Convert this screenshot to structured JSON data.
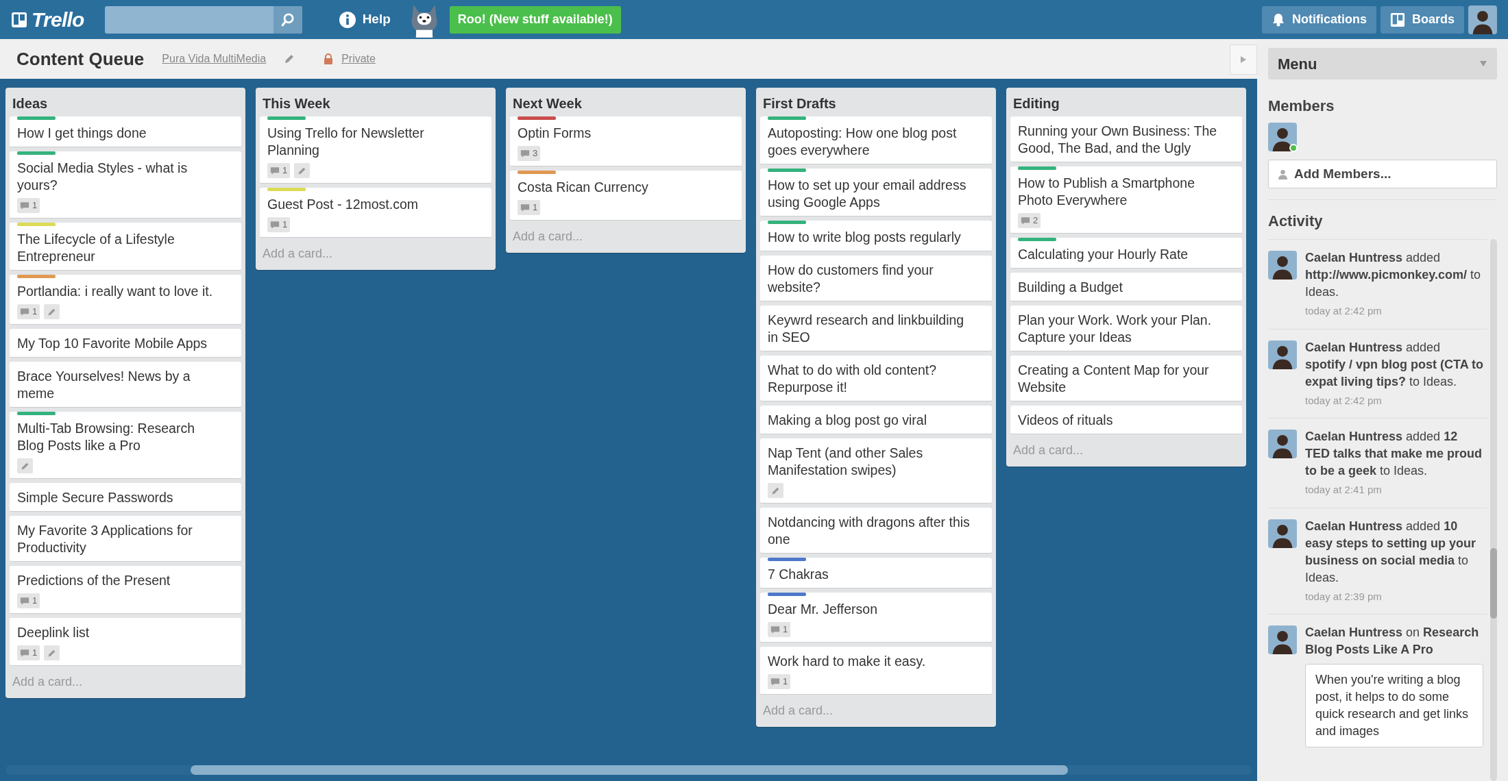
{
  "topbar": {
    "logo": "Trello",
    "help": "Help",
    "announcement": "Roo! (New stuff available!)",
    "notifications": "Notifications",
    "boards": "Boards"
  },
  "board": {
    "title": "Content Queue",
    "organization": "Pura Vida MultiMedia",
    "visibility": "Private"
  },
  "lists": [
    {
      "name": "Ideas",
      "add_card": "Add a card...",
      "cards": [
        {
          "title": "How I get things done",
          "labels": [
            {
              "color": "#34b27d"
            }
          ]
        },
        {
          "title": "Social Media Styles - what is yours?",
          "labels": [
            {
              "color": "#34b27d"
            }
          ],
          "comments": "1"
        },
        {
          "title": "The Lifecycle of a Lifestyle Entrepreneur",
          "labels": [
            {
              "color": "#dbdb57"
            }
          ]
        },
        {
          "title": "Portlandia: i really want to love it.",
          "labels": [
            {
              "color": "#e09952"
            }
          ],
          "comments": "1",
          "description": true
        },
        {
          "title": "My Top 10 Favorite Mobile Apps"
        },
        {
          "title": "Brace Yourselves! News by a meme"
        },
        {
          "title": "Multi-Tab Browsing: Research Blog Posts like a Pro",
          "labels": [
            {
              "color": "#34b27d"
            }
          ],
          "description": true
        },
        {
          "title": "Simple Secure Passwords"
        },
        {
          "title": "My Favorite 3 Applications for Productivity"
        },
        {
          "title": "Predictions of the Present",
          "comments": "1"
        },
        {
          "title": "Deeplink list",
          "comments": "1",
          "description": true
        }
      ]
    },
    {
      "name": "This Week",
      "add_card": "Add a card...",
      "cards": [
        {
          "title": "Using Trello for Newsletter Planning",
          "labels": [
            {
              "color": "#34b27d"
            }
          ],
          "comments": "1",
          "description": true
        },
        {
          "title": "Guest Post - 12most.com",
          "labels": [
            {
              "color": "#dbdb57"
            }
          ],
          "comments": "1"
        }
      ]
    },
    {
      "name": "Next Week",
      "add_card": "Add a card...",
      "cards": [
        {
          "title": "Optin Forms",
          "labels": [
            {
              "color": "#cb4d4d"
            }
          ],
          "comments": "3"
        },
        {
          "title": "Costa Rican Currency",
          "labels": [
            {
              "color": "#e09952"
            }
          ],
          "comments": "1"
        }
      ]
    },
    {
      "name": "First Drafts",
      "add_card": "Add a card...",
      "cards": [
        {
          "title": "Autoposting: How one blog post goes everywhere",
          "labels": [
            {
              "color": "#34b27d"
            }
          ]
        },
        {
          "title": "How to set up your email address using Google Apps",
          "labels": [
            {
              "color": "#34b27d"
            }
          ]
        },
        {
          "title": "How to write blog posts regularly",
          "labels": [
            {
              "color": "#34b27d"
            }
          ]
        },
        {
          "title": "How do customers find your website?"
        },
        {
          "title": "Keywrd research and linkbuilding in SEO"
        },
        {
          "title": "What to do with old content? Repurpose it!"
        },
        {
          "title": "Making a blog post go viral"
        },
        {
          "title": "Nap Tent (and other Sales Manifestation swipes)",
          "description": true
        },
        {
          "title": "Notdancing with dragons after this one"
        },
        {
          "title": "7 Chakras",
          "labels": [
            {
              "color": "#4d77cb"
            }
          ]
        },
        {
          "title": "Dear Mr. Jefferson",
          "labels": [
            {
              "color": "#4d77cb"
            }
          ],
          "comments": "1"
        },
        {
          "title": "Work hard to make it easy.",
          "comments": "1"
        }
      ]
    },
    {
      "name": "Editing",
      "add_card": "Add a card...",
      "cards": [
        {
          "title": "Running your Own Business: The Good, The Bad, and the Ugly"
        },
        {
          "title": "How to Publish a Smartphone Photo Everywhere",
          "labels": [
            {
              "color": "#34b27d"
            }
          ],
          "comments": "2"
        },
        {
          "title": "Calculating your Hourly Rate",
          "labels": [
            {
              "color": "#34b27d"
            }
          ]
        },
        {
          "title": "Building a Budget"
        },
        {
          "title": "Plan your Work. Work your Plan. Capture your Ideas"
        },
        {
          "title": "Creating a Content Map for your Website"
        },
        {
          "title": "Videos of rituals"
        }
      ]
    }
  ],
  "sidebar": {
    "menu": "Menu",
    "members_title": "Members",
    "members": [
      {
        "online": true
      }
    ],
    "add_members": "Add Members...",
    "activity_title": "Activity",
    "activity": [
      {
        "text": "**Caelan Huntress** added **http://www.picmonkey.com/** to Ideas.",
        "time": "today at 2:42 pm"
      },
      {
        "text": "**Caelan Huntress** added **spotify / vpn blog post (CTA to expat living tips?** to Ideas.",
        "time": "today at 2:42 pm"
      },
      {
        "text": "**Caelan Huntress** added **12 TED talks that make me proud to be a geek** to Ideas.",
        "time": "today at 2:41 pm"
      },
      {
        "text": "**Caelan Huntress** added **10 easy steps to setting up your business on social media** to Ideas.",
        "time": "today at 2:39 pm"
      },
      {
        "text": "**Caelan Huntress** on **Research Blog Posts Like A Pro**",
        "comment": "When you're writing a blog post, it helps to do some quick research and get links and images"
      }
    ]
  }
}
